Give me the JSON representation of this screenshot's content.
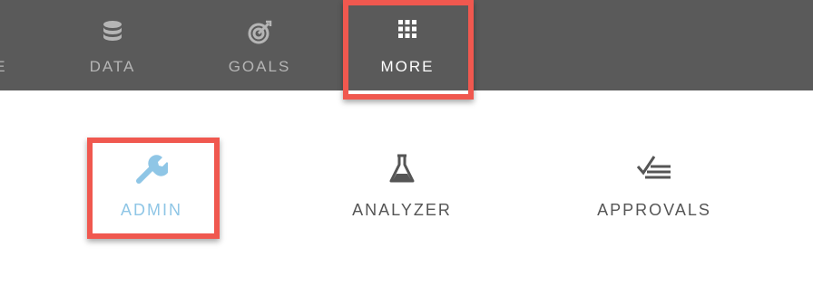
{
  "topnav": {
    "items": [
      {
        "label": "RE",
        "icon": "truncated-icon"
      },
      {
        "label": "DATA",
        "icon": "database-icon"
      },
      {
        "label": "GOALS",
        "icon": "target-icon"
      },
      {
        "label": "MORE",
        "icon": "grid-icon",
        "active": true
      }
    ]
  },
  "menu": {
    "items": [
      {
        "label": "ADMIN",
        "icon": "wrench-icon",
        "active": true
      },
      {
        "label": "ANALYZER",
        "icon": "flask-icon"
      },
      {
        "label": "APPROVALS",
        "icon": "checklist-icon"
      }
    ]
  },
  "colors": {
    "topbar": "#5a5a5a",
    "highlight": "#f0584f",
    "admin_accent": "#8fc6e6",
    "text": "#555555"
  }
}
